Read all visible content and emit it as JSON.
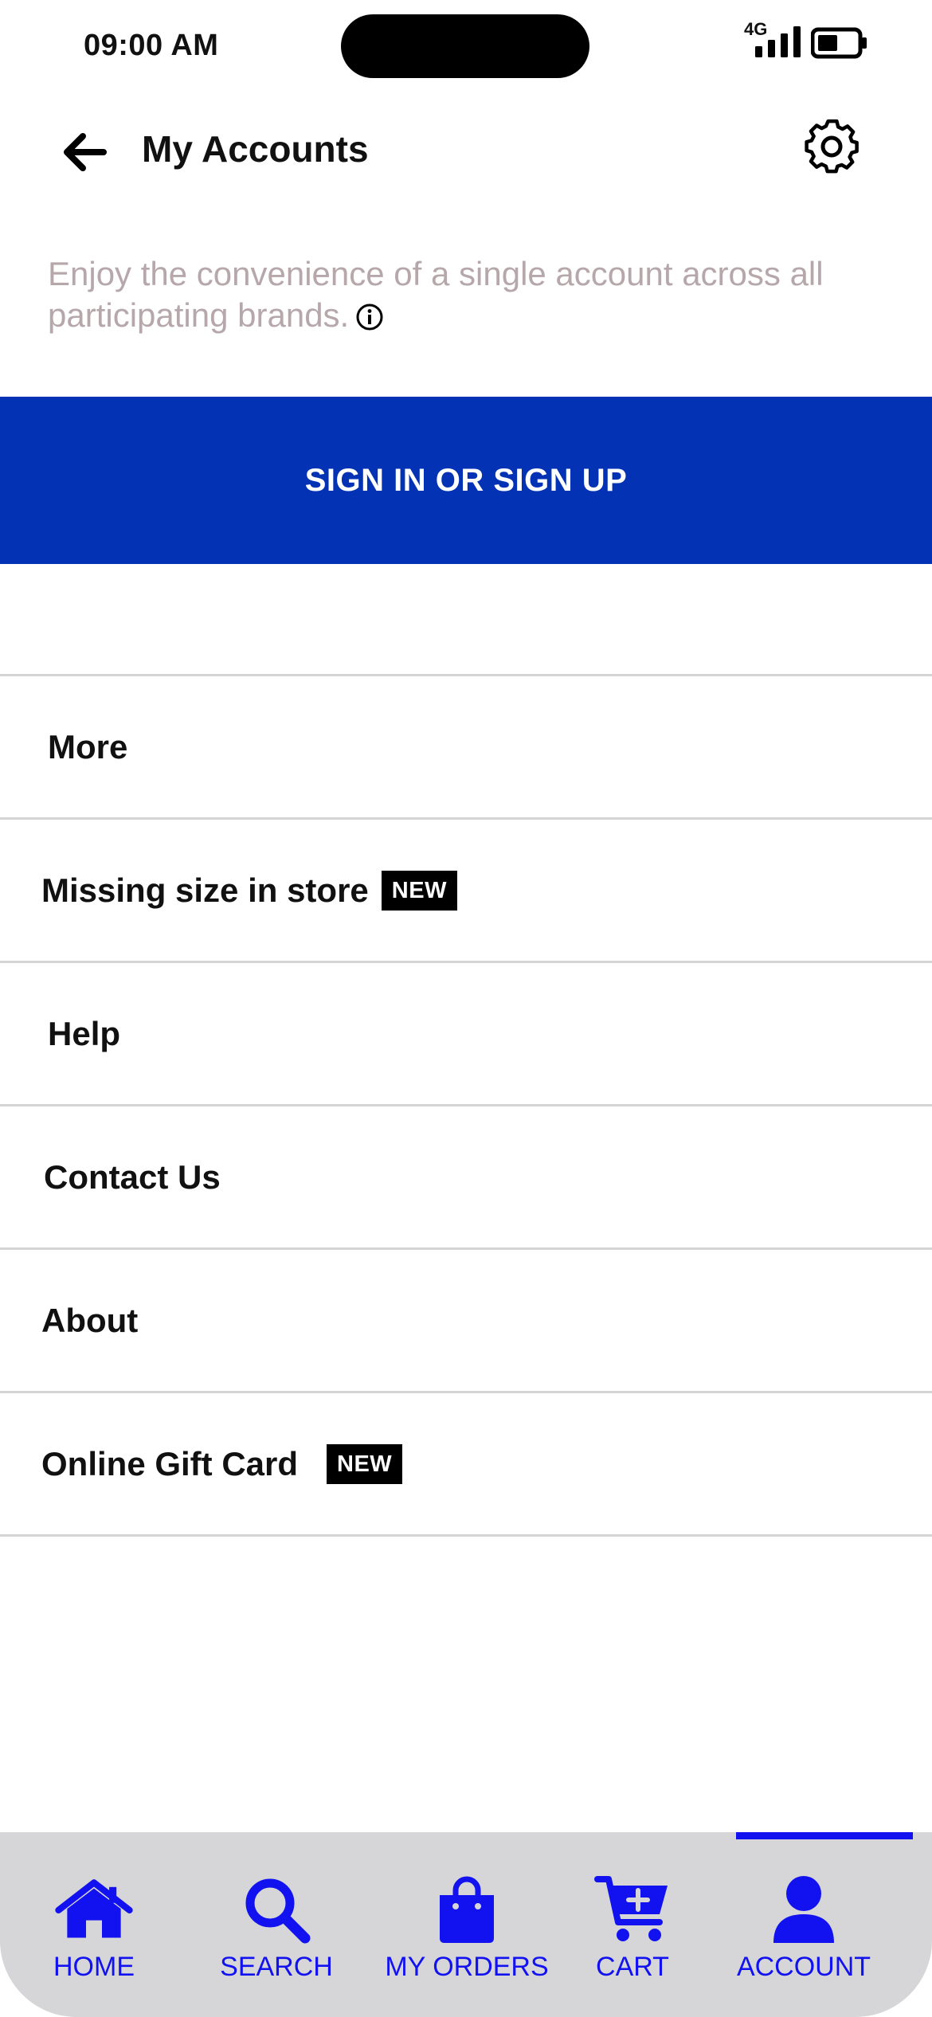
{
  "status_bar": {
    "time": "09:00 AM",
    "network": "4G"
  },
  "header": {
    "title": "My Accounts",
    "back_icon": "arrow-left-icon",
    "settings_icon": "gear-icon"
  },
  "intro": {
    "text": "Enjoy the convenience of a single account across all participating brands.",
    "info_icon": "info-circle-icon"
  },
  "signin": {
    "label": "SIGN IN OR SIGN UP"
  },
  "menu": {
    "items": [
      {
        "label": "More",
        "badge": ""
      },
      {
        "label": "Missing size in store",
        "badge": "NEW"
      },
      {
        "label": "Help",
        "badge": ""
      },
      {
        "label": "Contact Us",
        "badge": ""
      },
      {
        "label": "About",
        "badge": ""
      },
      {
        "label": "Online Gift Card",
        "badge": "NEW"
      }
    ]
  },
  "bottom_nav": {
    "items": [
      {
        "label": "HOME",
        "icon": "home-icon"
      },
      {
        "label": "SEARCH",
        "icon": "search-icon"
      },
      {
        "label": "MY ORDERS",
        "icon": "shopping-bag-icon"
      },
      {
        "label": "CART",
        "icon": "cart-icon"
      },
      {
        "label": "ACCOUNT",
        "icon": "user-icon"
      }
    ],
    "active": "ACCOUNT"
  },
  "colors": {
    "brand_blue": "#0333b4",
    "nav_accent": "#1212f0",
    "muted_text": "#b6a7ab",
    "nav_background": "#d6d6d8"
  }
}
